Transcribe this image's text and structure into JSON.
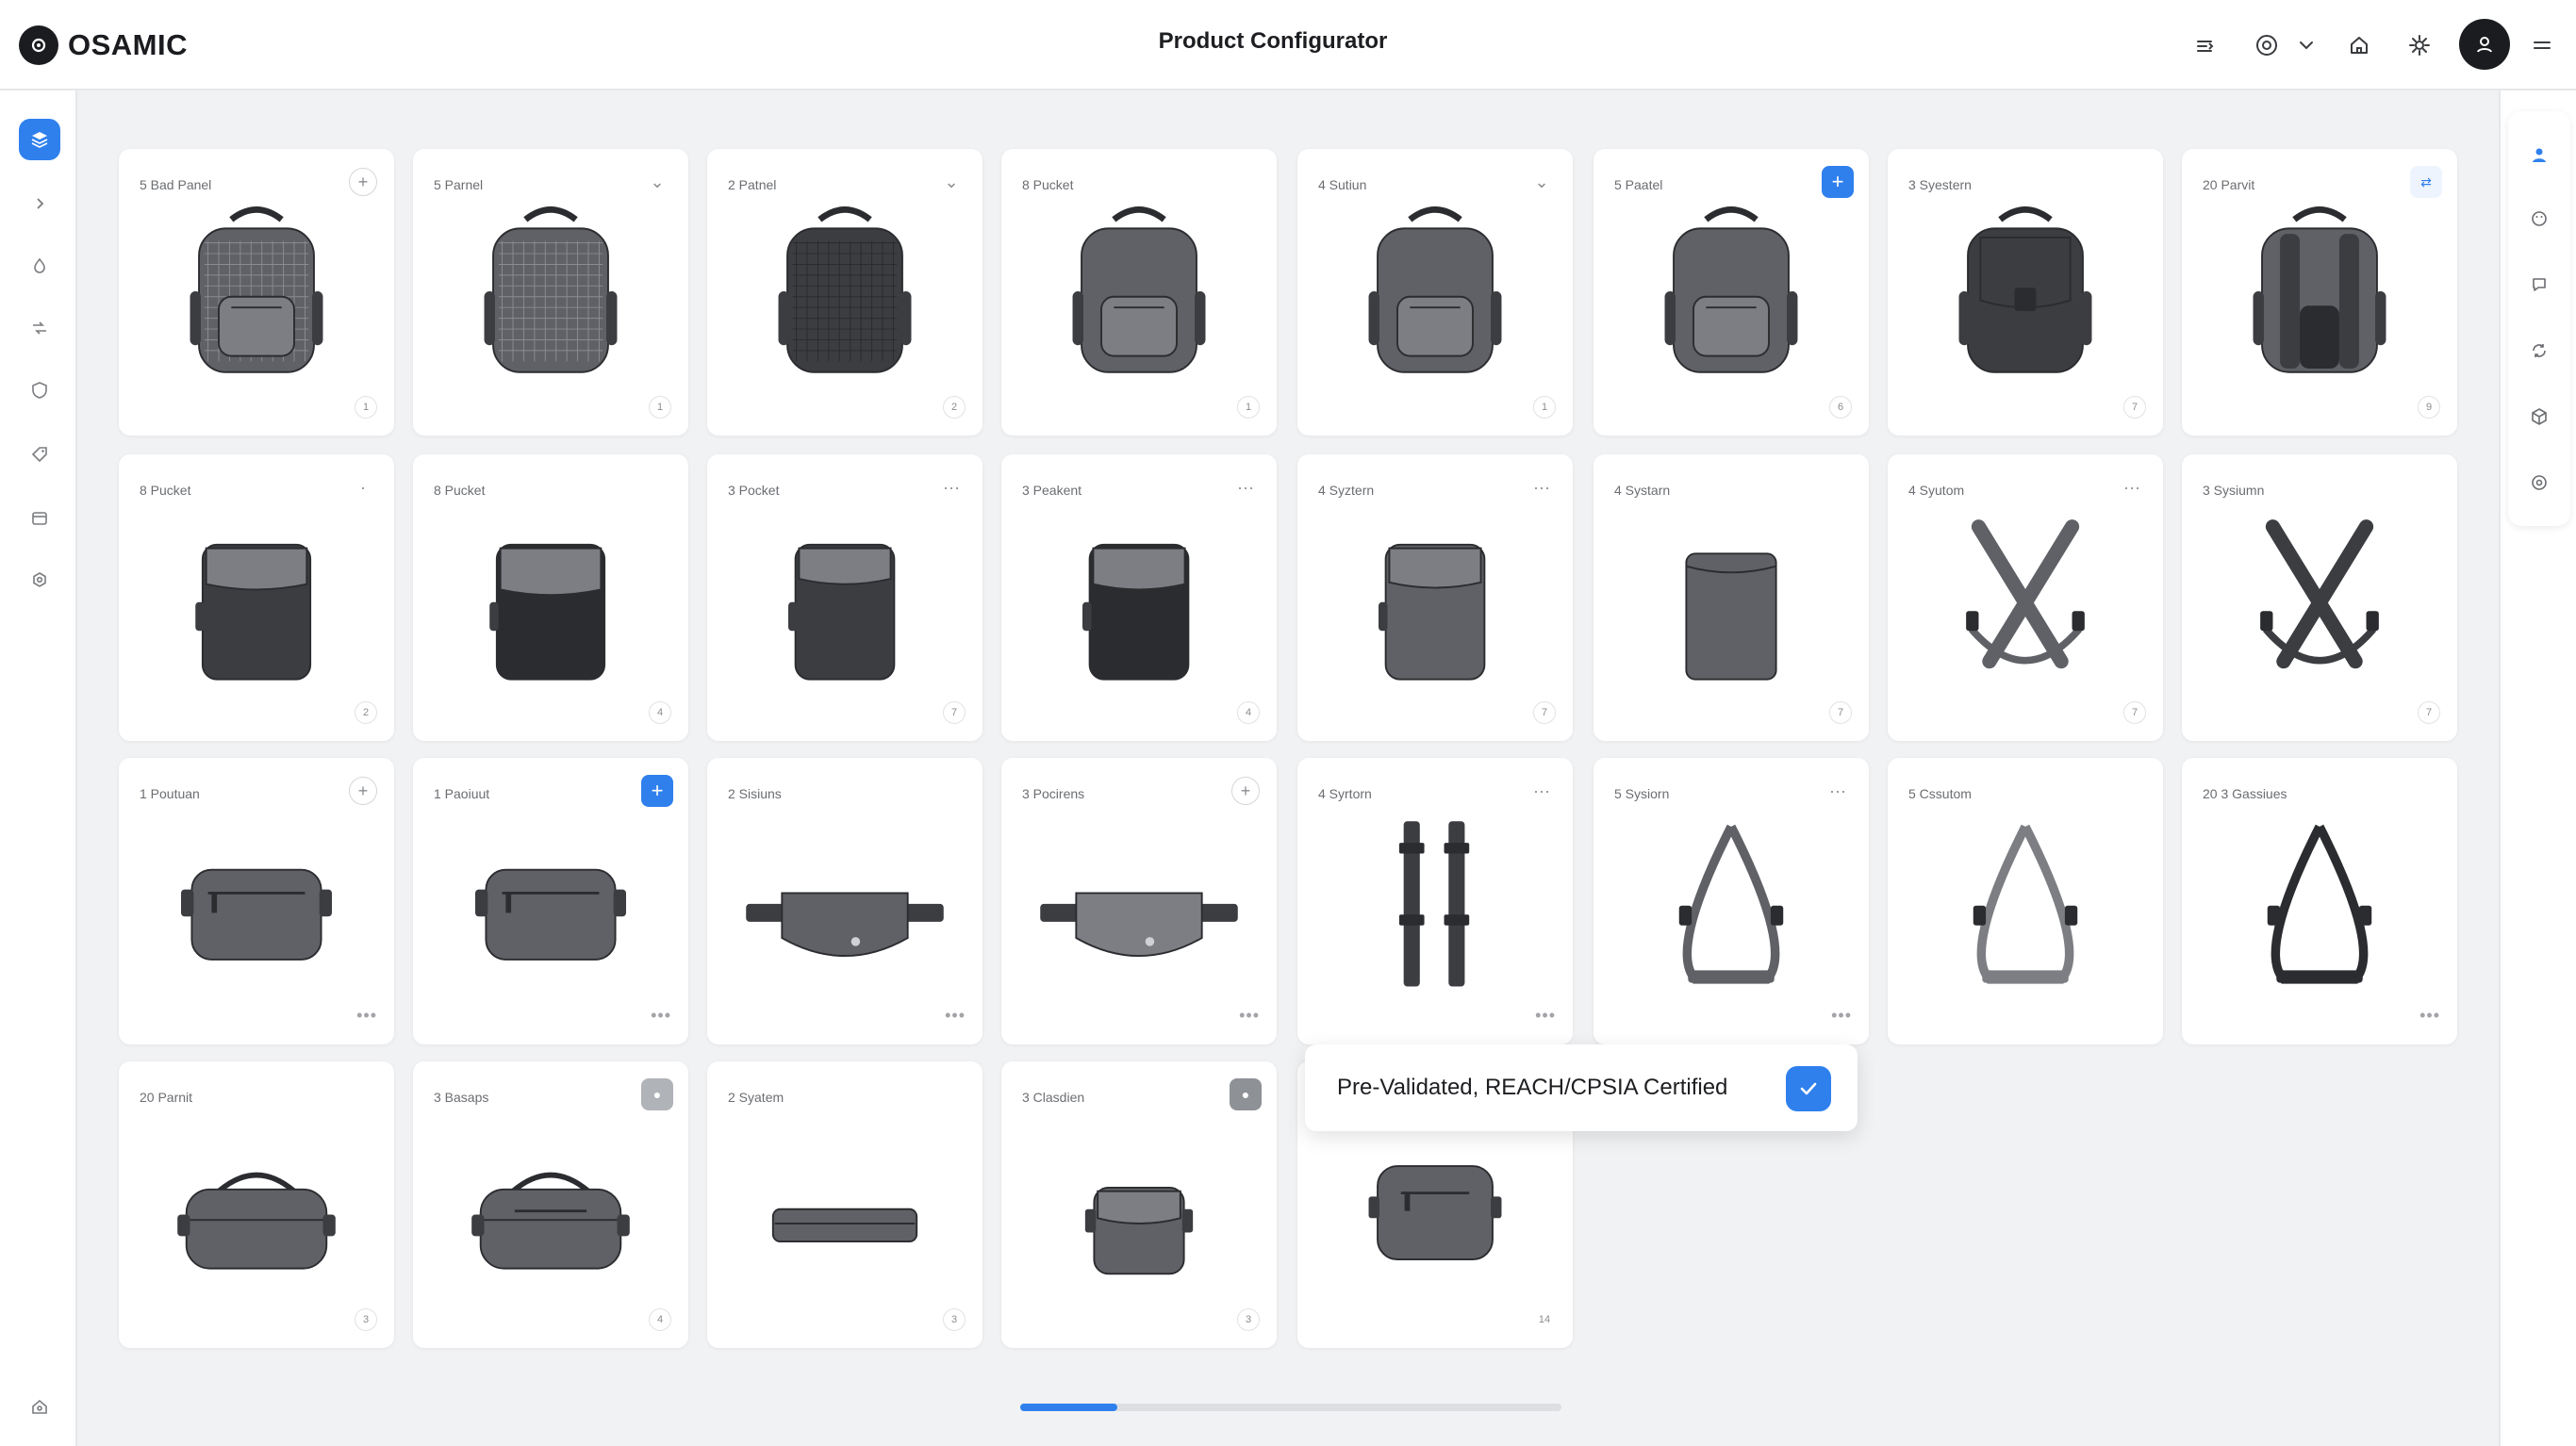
{
  "app": {
    "brand": "OSAMIC",
    "title": "Product Configurator"
  },
  "colors": {
    "accent": "#2f80ed",
    "dark": "#1b1c1f",
    "product_grey": "#5f6166",
    "product_dark": "#3b3d41"
  },
  "topbar_icons": [
    "export-icon",
    "help-icon",
    "chevron-down-icon",
    "home-icon",
    "settings-icon",
    "user-avatar",
    "menu-icon"
  ],
  "sidebar_icons": [
    "layers-icon",
    "chevron-right-icon",
    "droplet-icon",
    "flow-icon",
    "shield-icon",
    "tag-icon",
    "card-icon",
    "gear-icon",
    "support-icon"
  ],
  "rail_icons": [
    "user-icon",
    "palette-icon",
    "comment-icon",
    "refresh-icon",
    "box-icon",
    "help-icon"
  ],
  "cards": [
    {
      "label": "5 Bad Panel",
      "action": "plus-outline",
      "img": "backpack-mesh",
      "badge": "1"
    },
    {
      "label": "5 Parnel",
      "action": "chevron",
      "img": "backpack-mesh2",
      "badge": "1"
    },
    {
      "label": "2 Patnel",
      "action": "chevron",
      "img": "backpack-mesh-dark",
      "badge": "2"
    },
    {
      "label": "8 Pucket",
      "action": "none",
      "img": "backpack-plain",
      "badge": "1"
    },
    {
      "label": "4 Sutiun",
      "action": "chevron-small",
      "img": "backpack-plain",
      "badge": "1"
    },
    {
      "label": "5 Paatel",
      "action": "plus-blue",
      "img": "backpack-pocket",
      "badge": "6"
    },
    {
      "label": "3 Syestern",
      "action": "none",
      "img": "backpack-flap",
      "badge": "7"
    },
    {
      "label": "20 Parvit",
      "action": "link-icon",
      "img": "backpack-straps",
      "badge": "9"
    },
    {
      "label": "8 Pucket",
      "action": "dot",
      "img": "pocket-front",
      "badge": "2"
    },
    {
      "label": "8 Pucket",
      "action": "none",
      "img": "pocket-front-dark",
      "badge": "4"
    },
    {
      "label": "3 Pocket",
      "action": "dots",
      "img": "pocket-small",
      "badge": "7"
    },
    {
      "label": "3 Peakent",
      "action": "dots",
      "img": "pocket-small2",
      "badge": "4"
    },
    {
      "label": "4 Syztern",
      "action": "dots",
      "img": "sleeve-flap",
      "badge": "7"
    },
    {
      "label": "4 Systarn",
      "action": "none",
      "img": "sleeve-plain",
      "badge": "7"
    },
    {
      "label": "4 Syutom",
      "action": "dots",
      "img": "harness-x",
      "badge": "7"
    },
    {
      "label": "3 Sysiumn",
      "action": "none",
      "img": "harness-x-dark",
      "badge": "7"
    },
    {
      "label": "1 Poutuan",
      "action": "plus-outline",
      "img": "pouch-zip",
      "badge": "dots"
    },
    {
      "label": "1 Paoiuut",
      "action": "plus-blue",
      "img": "pouch-zip",
      "badge": "dots"
    },
    {
      "label": "2 Sisiuns",
      "action": "none",
      "img": "hip-pouch",
      "badge": "dots"
    },
    {
      "label": "3 Pocirens",
      "action": "plus-outline",
      "img": "hip-pouch-light",
      "badge": "dots"
    },
    {
      "label": "4 Syrtorn",
      "action": "dots",
      "img": "straps-pair",
      "badge": "dots"
    },
    {
      "label": "5 Sysiorn",
      "action": "dots",
      "img": "strap-loop",
      "badge": "dots"
    },
    {
      "label": "5 Cssutom",
      "action": "none",
      "img": "strap-loop2",
      "badge": "none"
    },
    {
      "label": "20 3 Gassiues",
      "action": "none",
      "img": "strap-loop-dark",
      "badge": "dots"
    },
    {
      "label": "20 Parnit",
      "action": "none",
      "img": "case-handle",
      "badge": "3"
    },
    {
      "label": "3 Basaps",
      "action": "plus-grey",
      "img": "case-handle-zip",
      "badge": "4"
    },
    {
      "label": "2 Syatem",
      "action": "none",
      "img": "flat-case",
      "badge": "3"
    },
    {
      "label": "3 Clasdien",
      "action": "plus-dark",
      "img": "small-pouch",
      "badge": "3"
    },
    {
      "label": "",
      "action": "none",
      "img": "mini-case",
      "badge": "14"
    }
  ],
  "toast": {
    "text": "Pre-Validated, REACH/CPSIA Certified",
    "icon": "check-icon"
  },
  "scroll": {
    "progress": 0.18
  }
}
